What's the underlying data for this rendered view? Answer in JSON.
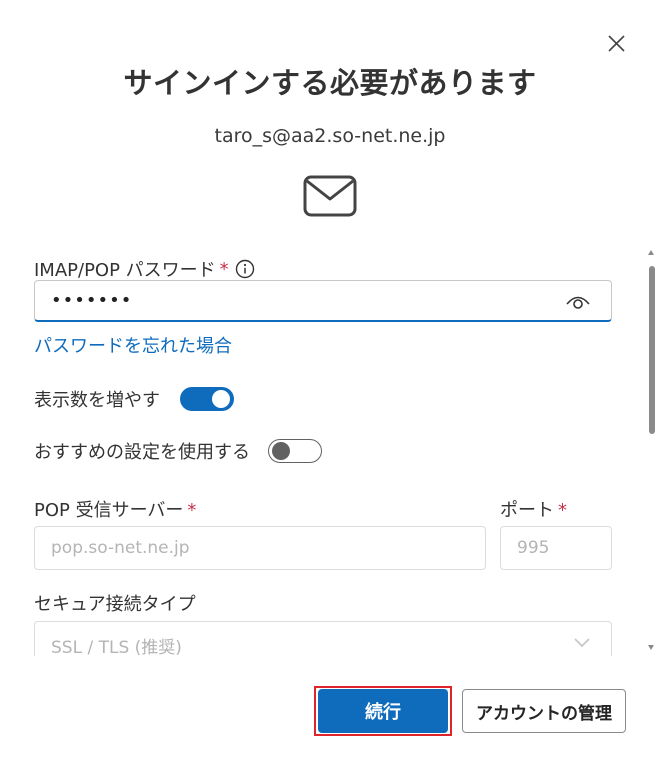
{
  "dialog": {
    "title": "サインインする必要があります",
    "email": "taro_s@aa2.so-net.ne.jp",
    "close_icon": "close-icon",
    "mail_icon": "mail-icon"
  },
  "password": {
    "label": "IMAP/POP パスワード",
    "required_mark": "*",
    "value": "•••••••",
    "forgot_link": "パスワードを忘れた場合"
  },
  "toggles": {
    "show_more_label": "表示数を増やす",
    "show_more_on": true,
    "recommended_label": "おすすめの設定を使用する",
    "recommended_on": false
  },
  "server": {
    "label": "POP 受信サーバー",
    "required_mark": "*",
    "placeholder": "pop.so-net.ne.jp",
    "port_label": "ポート",
    "port_required_mark": "*",
    "port_placeholder": "995"
  },
  "security": {
    "label": "セキュア接続タイプ",
    "selected": "SSL / TLS (推奨)"
  },
  "buttons": {
    "continue": "続行",
    "manage_account": "アカウントの管理"
  },
  "colors": {
    "accent": "#0f6cbd",
    "required": "#c4314b",
    "highlight": "#e0242b"
  }
}
